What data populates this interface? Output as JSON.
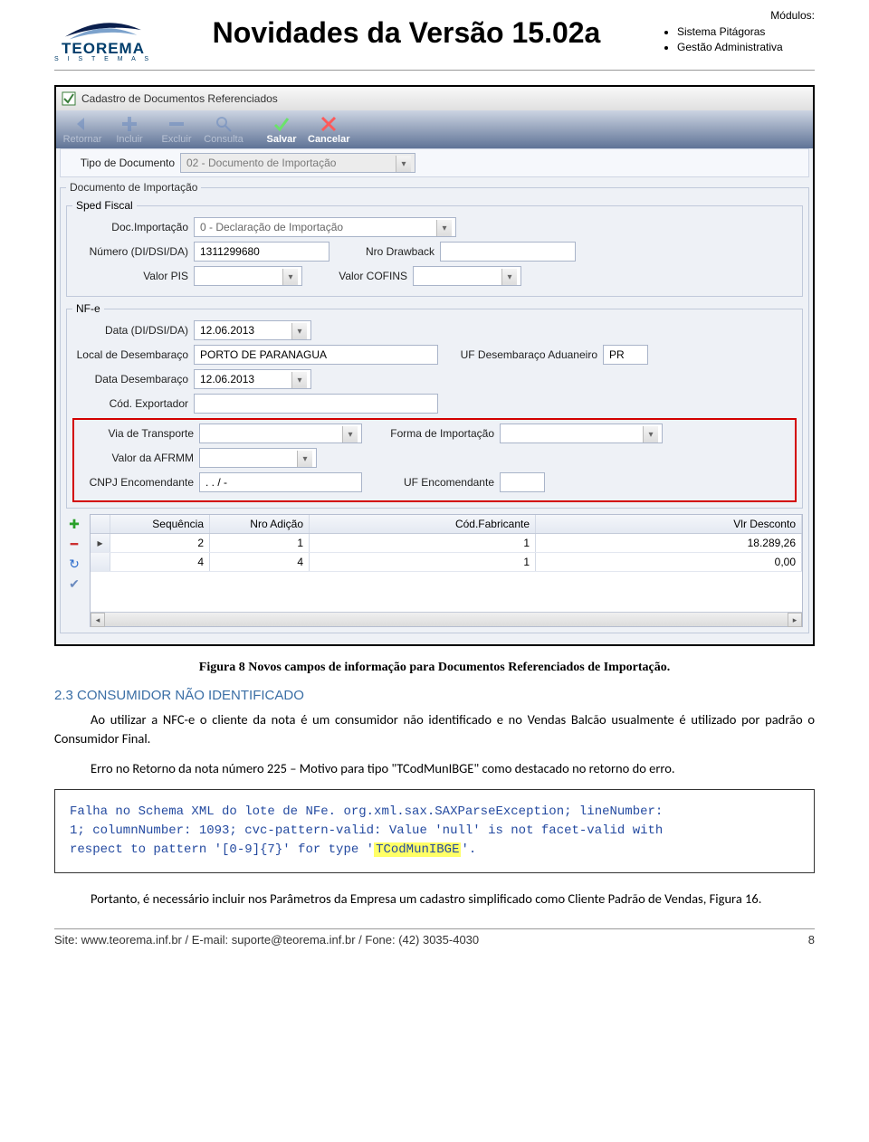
{
  "header": {
    "logo_main": "TEOREMA",
    "logo_sub": "S I S T E M A S",
    "title": "Novidades da Versão 15.02a",
    "modules_label": "Módulos:",
    "modules": [
      "Sistema Pitágoras",
      "Gestão Administrativa"
    ]
  },
  "window": {
    "title": "Cadastro de Documentos Referenciados",
    "toolbar": {
      "retornar": "Retornar",
      "incluir": "Incluir",
      "excluir": "Excluir",
      "consulta": "Consulta",
      "salvar": "Salvar",
      "cancelar": "Cancelar"
    },
    "tipo_doc_label": "Tipo de Documento",
    "tipo_doc_value": "02 - Documento de Importação",
    "group_main": "Documento de Importação",
    "group_sped": "Sped Fiscal",
    "doc_import_label": "Doc.Importação",
    "doc_import_value": "0 - Declaração de Importação",
    "numero_label": "Número (DI/DSI/DA)",
    "numero_value": "1311299680",
    "nro_drawback_label": "Nro Drawback",
    "nro_drawback_value": "",
    "valor_pis_label": "Valor PIS",
    "valor_pis_value": "",
    "valor_cofins_label": "Valor COFINS",
    "valor_cofins_value": "",
    "group_nfe": "NF-e",
    "data_didsi_label": "Data (DI/DSI/DA)",
    "data_didsi_value": "12.06.2013",
    "local_desemb_label": "Local de Desembaraço",
    "local_desemb_value": "PORTO DE PARANAGUA",
    "uf_desemb_label": "UF Desembaraço Aduaneiro",
    "uf_desemb_value": "PR",
    "data_desemb_label": "Data Desembaraço",
    "data_desemb_value": "12.06.2013",
    "cod_export_label": "Cód. Exportador",
    "cod_export_value": "",
    "via_transp_label": "Via de Transporte",
    "via_transp_value": "",
    "forma_import_label": "Forma de Importação",
    "forma_import_value": "",
    "valor_afrmm_label": "Valor da AFRMM",
    "valor_afrmm_value": "",
    "cnpj_encom_label": "CNPJ Encomendante",
    "cnpj_encom_value": ".  .  /  -",
    "uf_encom_label": "UF Encomendante",
    "uf_encom_value": "",
    "grid": {
      "headers": {
        "seq": "Sequência",
        "add": "Nro Adição",
        "fab": "Cód.Fabricante",
        "vlr": "Vlr Desconto"
      },
      "rows": [
        {
          "seq": "2",
          "add": "1",
          "fab": "1",
          "vlr": "18.289,26"
        },
        {
          "seq": "4",
          "add": "4",
          "fab": "1",
          "vlr": "0,00"
        }
      ]
    }
  },
  "caption": "Figura 8 Novos campos de informação para Documentos Referenciados de Importação.",
  "section": {
    "num": "2.3",
    "title": "CONSUMIDOR NÃO IDENTIFICADO"
  },
  "para1": "Ao utilizar a NFC-e o cliente da nota é um consumidor não identificado e no Vendas Balcão usualmente é utilizado por padrão o Consumidor Final.",
  "para2": "Erro no Retorno da nota número 225 – Motivo para tipo \"TCodMunIBGE\" como destacado no retorno do erro.",
  "error": {
    "l1": "Falha no Schema XML do lote de NFe. org.xml.sax.SAXParseException; lineNumber:",
    "l2": "1; columnNumber: 1093; cvc-pattern-valid: Value 'null' is not facet-valid with",
    "l3_pre": "respect to pattern '[0-9]{7}' for type '",
    "l3_hl": "TCodMunIBGE",
    "l3_post": "'."
  },
  "para3": "Portanto, é necessário incluir nos Parâmetros da Empresa um cadastro simplificado como Cliente Padrão de Vendas, Figura 16.",
  "footer": {
    "left": "Site: www.teorema.inf.br / E-mail: suporte@teorema.inf.br / Fone: (42) 3035-4030",
    "page": "8"
  }
}
